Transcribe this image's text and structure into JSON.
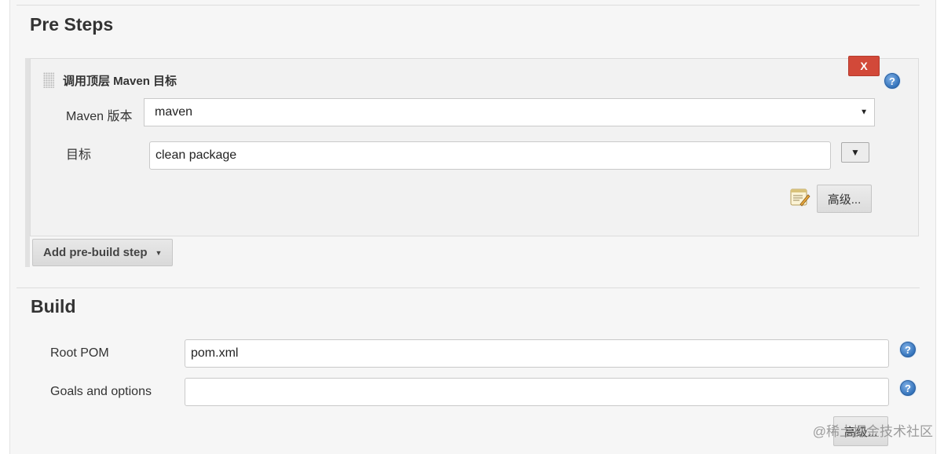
{
  "pre_steps": {
    "title": "Pre Steps",
    "step": {
      "title": "调用顶层 Maven 目标",
      "delete_label": "X",
      "maven_version_label": "Maven 版本",
      "maven_version_value": "maven",
      "goals_label": "目标",
      "goals_value": "clean package",
      "dropdown_glyph": "▼",
      "advanced_label": "高级..."
    },
    "add_step_label": "Add pre-build step",
    "add_step_caret": "▼"
  },
  "build": {
    "title": "Build",
    "root_pom_label": "Root POM",
    "root_pom_value": "pom.xml",
    "goals_options_label": "Goals and options",
    "goals_options_value": "",
    "advanced_label": "高级..."
  },
  "help_glyph": "?",
  "select_arrow": "▼",
  "watermark": "@稀土掘金技术社区"
}
